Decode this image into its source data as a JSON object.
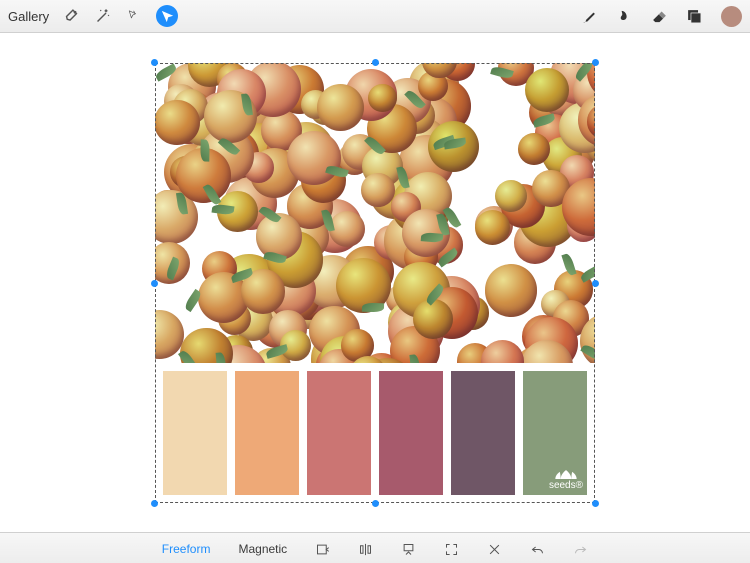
{
  "topbar": {
    "gallery_label": "Gallery",
    "current_color": "#b78c7e"
  },
  "selection": {
    "image_description": "pile of peaches",
    "palette": [
      {
        "hex": "#f2d8b0"
      },
      {
        "hex": "#eea977"
      },
      {
        "hex": "#cb7573"
      },
      {
        "hex": "#a75a6c"
      },
      {
        "hex": "#6f5666"
      },
      {
        "hex": "#879c7a"
      }
    ],
    "brand_text": "seeds®"
  },
  "bottombar": {
    "freeform_label": "Freeform",
    "magnetic_label": "Magnetic"
  }
}
